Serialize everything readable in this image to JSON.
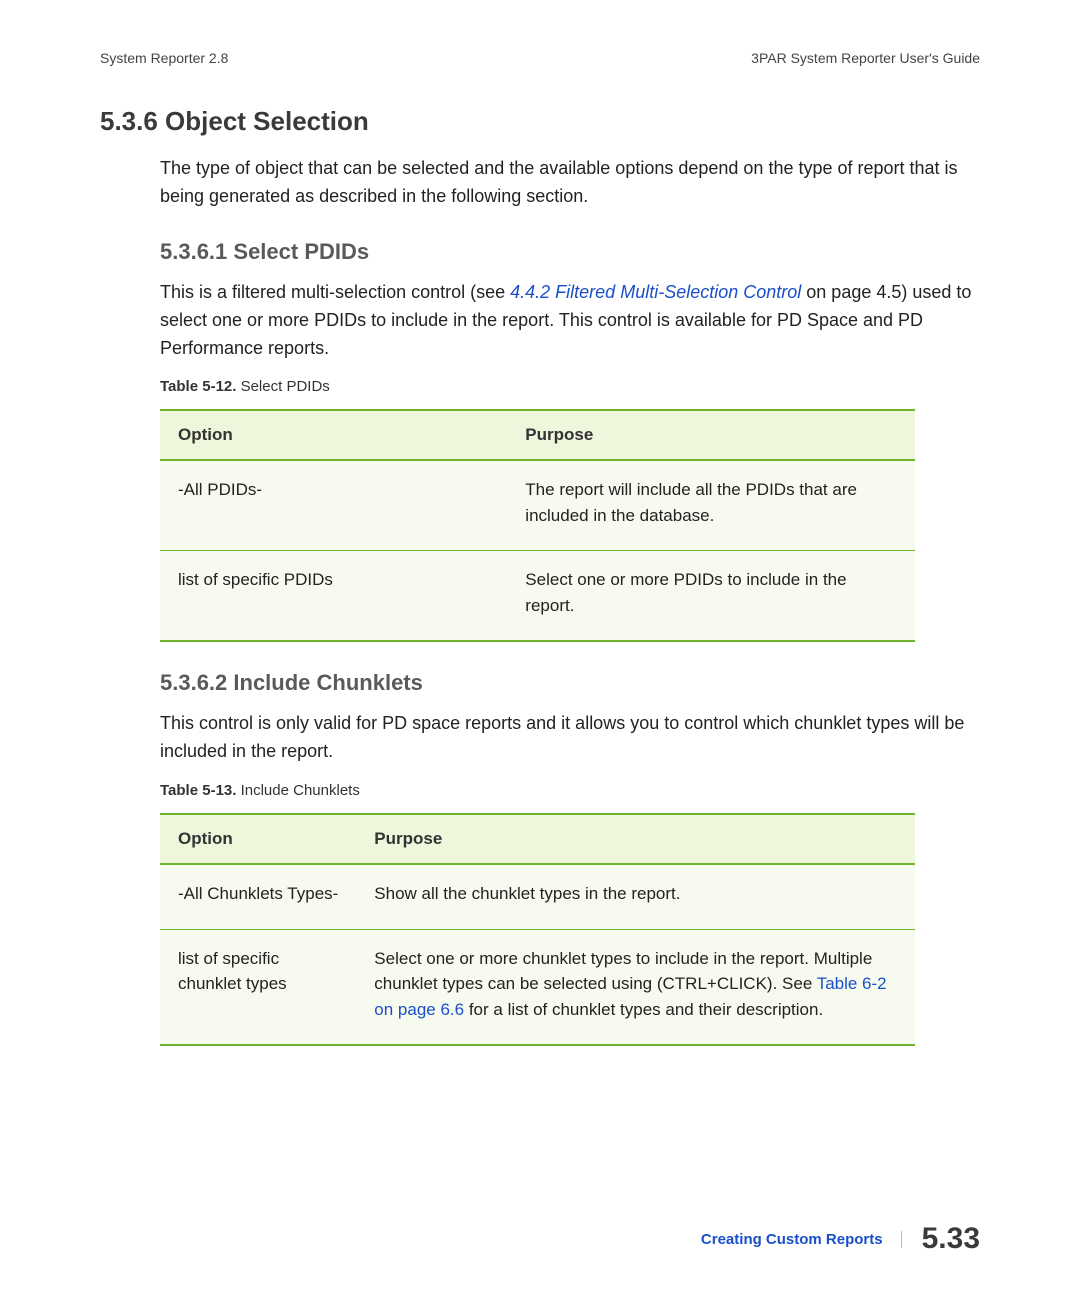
{
  "header": {
    "left": "System Reporter 2.8",
    "right": "3PAR System Reporter User's Guide"
  },
  "section": {
    "number_title": "5.3.6 Object Selection",
    "intro": "The type of object that can be selected and the available options depend on the type of report that is being generated as described in the following section."
  },
  "sub1": {
    "number_title": "5.3.6.1 Select PDIDs",
    "text_before_link": "This is a filtered multi-selection control (see ",
    "link_text": "4.4.2 Filtered Multi-Selection Control",
    "text_after_link": " on page 4.5) used to select one or more PDIDs to include in the report. This control is available for PD Space and PD Performance reports.",
    "table_caption_bold": "Table 5-12.",
    "table_caption_rest": "  Select PDIDs",
    "table": {
      "headers": {
        "option": "Option",
        "purpose": "Purpose"
      },
      "rows": [
        {
          "option": "-All PDIDs-",
          "purpose": "The report will include all the PDIDs that are included in the database."
        },
        {
          "option": "list of specific PDIDs",
          "purpose": "Select one or more PDIDs to include in the report."
        }
      ]
    }
  },
  "sub2": {
    "number_title": "5.3.6.2 Include Chunklets",
    "intro": "This control is only valid for PD space reports and it allows you to control which chunklet types will be included in the report.",
    "table_caption_bold": "Table 5-13.",
    "table_caption_rest": "  Include Chunklets",
    "table": {
      "headers": {
        "option": "Option",
        "purpose": "Purpose"
      },
      "rows": [
        {
          "option": "-All Chunklets Types-",
          "purpose": "Show all the chunklet types in the report."
        },
        {
          "option": "list of specific chunklet types",
          "purpose_before": "Select one or more chunklet types to include in the report. Multiple chunklet types can be selected using (CTRL+CLICK). See ",
          "purpose_link": "Table 6-2 on page 6.6",
          "purpose_after": " for a list of chunklet types and their description."
        }
      ]
    }
  },
  "footer": {
    "chapter": "Creating Custom Reports",
    "page": "5.33"
  }
}
